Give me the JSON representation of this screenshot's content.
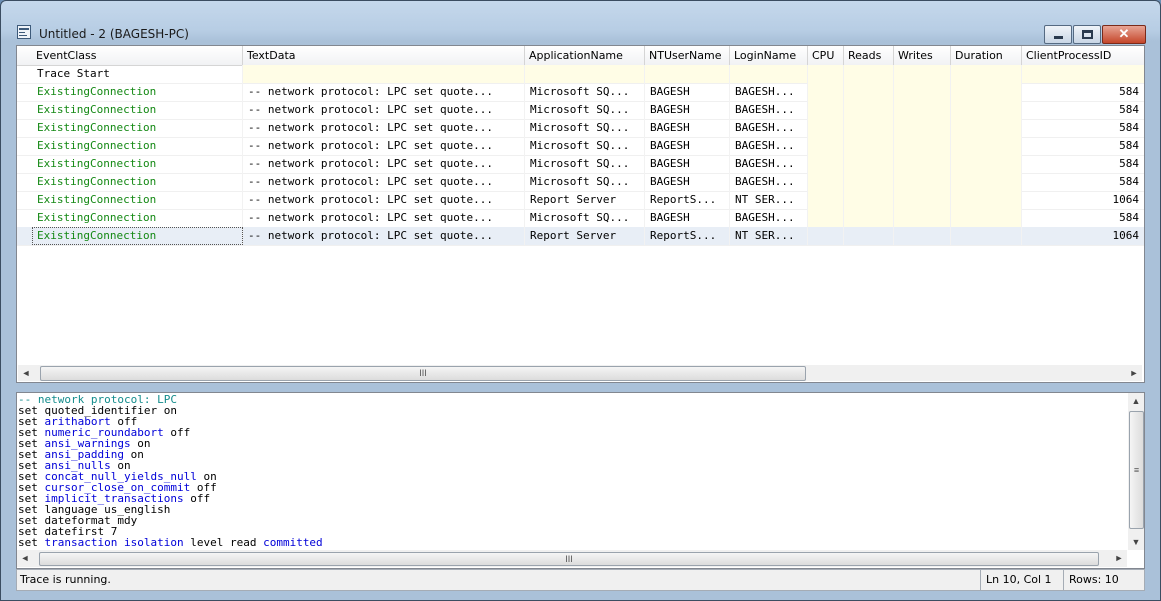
{
  "window": {
    "title": "Untitled - 2 (BAGESH-PC)",
    "close_glyph": "✕"
  },
  "columns": [
    "EventClass",
    "TextData",
    "ApplicationName",
    "NTUserName",
    "LoginName",
    "CPU",
    "Reads",
    "Writes",
    "Duration",
    "ClientProcessID"
  ],
  "rows": [
    {
      "event": "Trace Start",
      "text": "",
      "app": "",
      "nt": "",
      "login": "",
      "pid": ""
    },
    {
      "event": "ExistingConnection",
      "text": "-- network protocol: LPC  set quote...",
      "app": "Microsoft SQ...",
      "nt": "BAGESH",
      "login": "BAGESH...",
      "pid": "584"
    },
    {
      "event": "ExistingConnection",
      "text": "-- network protocol: LPC  set quote...",
      "app": "Microsoft SQ...",
      "nt": "BAGESH",
      "login": "BAGESH...",
      "pid": "584"
    },
    {
      "event": "ExistingConnection",
      "text": "-- network protocol: LPC  set quote...",
      "app": "Microsoft SQ...",
      "nt": "BAGESH",
      "login": "BAGESH...",
      "pid": "584"
    },
    {
      "event": "ExistingConnection",
      "text": "-- network protocol: LPC  set quote...",
      "app": "Microsoft SQ...",
      "nt": "BAGESH",
      "login": "BAGESH...",
      "pid": "584"
    },
    {
      "event": "ExistingConnection",
      "text": "-- network protocol: LPC  set quote...",
      "app": "Microsoft SQ...",
      "nt": "BAGESH",
      "login": "BAGESH...",
      "pid": "584"
    },
    {
      "event": "ExistingConnection",
      "text": "-- network protocol: LPC  set quote...",
      "app": "Microsoft SQ...",
      "nt": "BAGESH",
      "login": "BAGESH...",
      "pid": "584"
    },
    {
      "event": "ExistingConnection",
      "text": "-- network protocol: LPC  set quote...",
      "app": "Report Server",
      "nt": "ReportS...",
      "login": "NT SER...",
      "pid": "1064"
    },
    {
      "event": "ExistingConnection",
      "text": "-- network protocol: LPC  set quote...",
      "app": "Microsoft SQ...",
      "nt": "BAGESH",
      "login": "BAGESH...",
      "pid": "584"
    },
    {
      "event": "ExistingConnection",
      "text": "-- network protocol: LPC  set quote...",
      "app": "Report Server",
      "nt": "ReportS...",
      "login": "NT SER...",
      "pid": "1064"
    }
  ],
  "text_lines": [
    [
      {
        "t": "-- network protocol: LPC",
        "c": "cm"
      }
    ],
    [
      {
        "t": "set quoted_identifier on",
        "c": ""
      }
    ],
    [
      {
        "t": "set ",
        "c": ""
      },
      {
        "t": "arithabort",
        "c": "kw"
      },
      {
        "t": " off",
        "c": ""
      }
    ],
    [
      {
        "t": "set ",
        "c": ""
      },
      {
        "t": "numeric_roundabort",
        "c": "kw"
      },
      {
        "t": " off",
        "c": ""
      }
    ],
    [
      {
        "t": "set ",
        "c": ""
      },
      {
        "t": "ansi_warnings",
        "c": "kw"
      },
      {
        "t": " on",
        "c": ""
      }
    ],
    [
      {
        "t": "set ",
        "c": ""
      },
      {
        "t": "ansi_padding",
        "c": "kw"
      },
      {
        "t": " on",
        "c": ""
      }
    ],
    [
      {
        "t": "set ",
        "c": ""
      },
      {
        "t": "ansi_nulls",
        "c": "kw"
      },
      {
        "t": " on",
        "c": ""
      }
    ],
    [
      {
        "t": "set ",
        "c": ""
      },
      {
        "t": "concat_null_yields_null",
        "c": "kw"
      },
      {
        "t": " on",
        "c": ""
      }
    ],
    [
      {
        "t": "set ",
        "c": ""
      },
      {
        "t": "cursor_close_on_commit",
        "c": "kw"
      },
      {
        "t": " off",
        "c": ""
      }
    ],
    [
      {
        "t": "set ",
        "c": ""
      },
      {
        "t": "implicit_transactions",
        "c": "kw"
      },
      {
        "t": " off",
        "c": ""
      }
    ],
    [
      {
        "t": "set language us_english",
        "c": ""
      }
    ],
    [
      {
        "t": "set dateformat mdy",
        "c": ""
      }
    ],
    [
      {
        "t": "set datefirst 7",
        "c": ""
      }
    ],
    [
      {
        "t": "set ",
        "c": ""
      },
      {
        "t": "transaction",
        "c": "kw"
      },
      {
        "t": " ",
        "c": ""
      },
      {
        "t": "isolation",
        "c": "kw"
      },
      {
        "t": " level read ",
        "c": ""
      },
      {
        "t": "committed",
        "c": "kw"
      }
    ]
  ],
  "scroll": {
    "grip": "III",
    "left": "◄",
    "right": "►",
    "up": "▲",
    "down": "▼",
    "vgrip": "≡"
  },
  "status": {
    "message": "Trace is running.",
    "position": "Ln 10, Col 1",
    "rows": "Rows: 10"
  },
  "colors": {
    "event_green": "#148914",
    "keyword_blue": "#0000d8",
    "comment_teal": "#138c8c",
    "empty_cell_yellow": "#fffde6"
  }
}
